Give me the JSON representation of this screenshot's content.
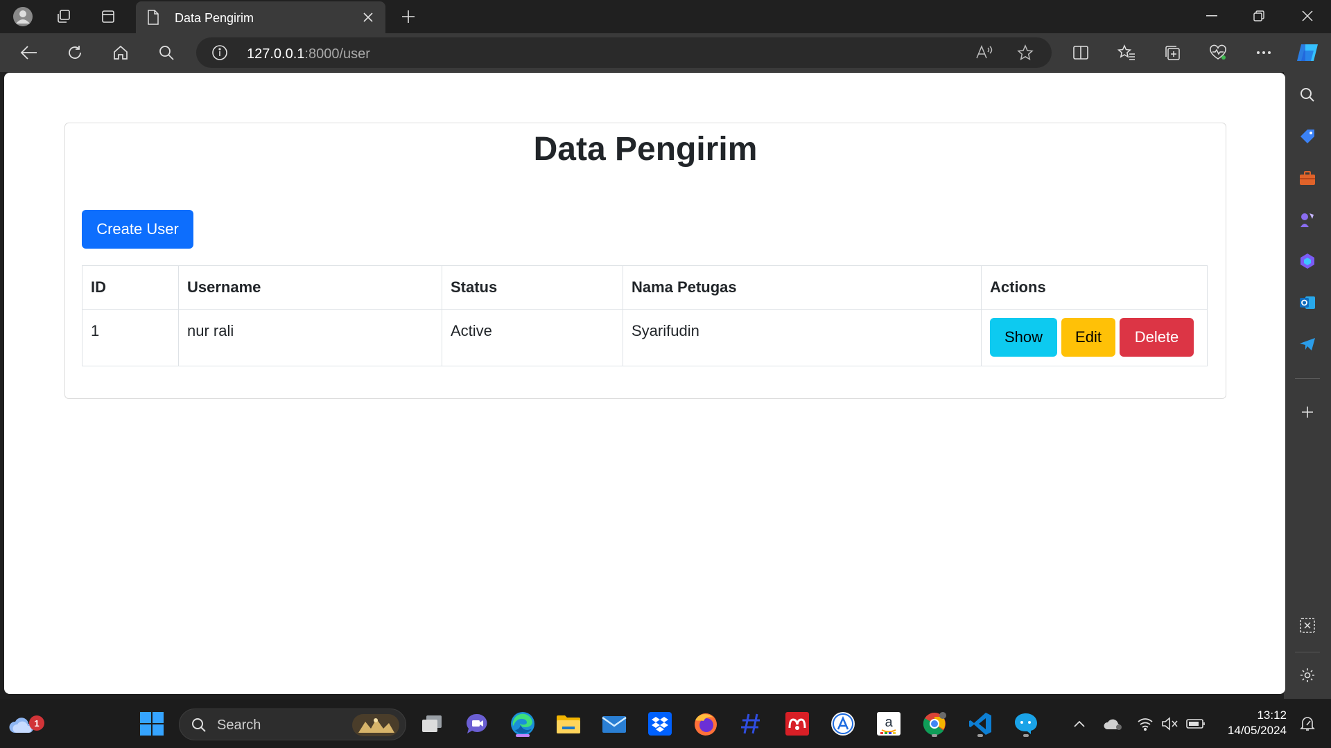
{
  "browser": {
    "tab_title": "Data Pengirim",
    "url_host": "127.0.0.1",
    "url_path": ":8000/user"
  },
  "page": {
    "title": "Data Pengirim",
    "create_button": "Create User",
    "table": {
      "headers": [
        "ID",
        "Username",
        "Status",
        "Nama Petugas",
        "Actions"
      ],
      "rows": [
        {
          "id": "1",
          "username": "nur rali",
          "status": "Active",
          "nama_petugas": "Syarifudin"
        }
      ],
      "actions": {
        "show": "Show",
        "edit": "Edit",
        "delete": "Delete"
      }
    }
  },
  "taskbar": {
    "search_label": "Search",
    "weather_badge": "1",
    "time": "13:12",
    "date": "14/05/2024"
  },
  "colors": {
    "primary": "#0d6efd",
    "info": "#0dcaf0",
    "warning": "#ffc107",
    "danger": "#dc3545"
  }
}
